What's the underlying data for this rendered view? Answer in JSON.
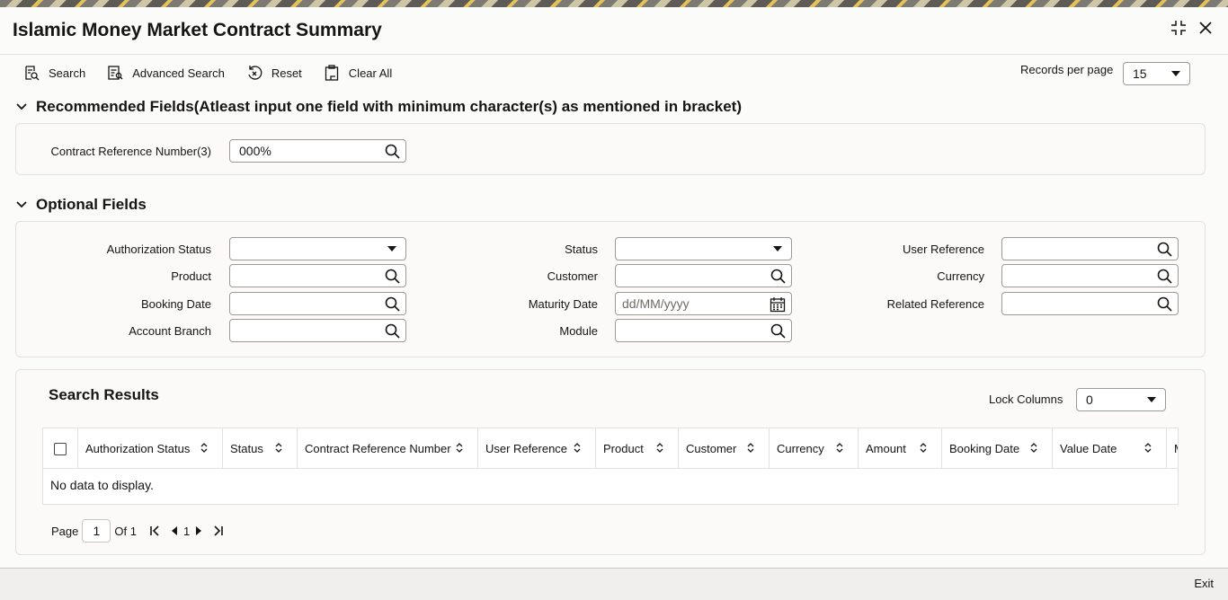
{
  "window": {
    "title": "Islamic Money Market Contract Summary"
  },
  "toolbar": {
    "search_label": "Search",
    "advanced_search_label": "Advanced Search",
    "reset_label": "Reset",
    "clear_all_label": "Clear All",
    "records_per_page_label": "Records per page",
    "records_per_page_value": "15"
  },
  "recommended": {
    "heading": "Recommended Fields(Atleast input one field with minimum character(s) as mentioned in bracket)",
    "contract_ref_label": "Contract Reference Number(3)",
    "contract_ref_value": "000%"
  },
  "optional": {
    "heading": "Optional Fields",
    "authorization_status_label": "Authorization Status",
    "authorization_status_value": "",
    "product_label": "Product",
    "booking_date_label": "Booking Date",
    "account_branch_label": "Account Branch",
    "status_label": "Status",
    "status_value": "",
    "customer_label": "Customer",
    "maturity_date_label": "Maturity Date",
    "maturity_date_placeholder": "dd/MM/yyyy",
    "module_label": "Module",
    "user_reference_label": "User Reference",
    "currency_label": "Currency",
    "related_reference_label": "Related Reference"
  },
  "results": {
    "heading": "Search Results",
    "lock_columns_label": "Lock Columns",
    "lock_columns_value": "0",
    "columns": [
      "Authorization Status",
      "Status",
      "Contract Reference Number",
      "User Reference",
      "Product",
      "Customer",
      "Currency",
      "Amount",
      "Booking Date",
      "Value Date",
      "M"
    ],
    "empty_message": "No data to display."
  },
  "pager": {
    "page_label": "Page",
    "page_value": "1",
    "of_label": "Of 1",
    "current_page": "1"
  },
  "footer": {
    "exit_label": "Exit"
  },
  "icons": {
    "maximize": "maximize-icon",
    "close": "close-icon",
    "search": "search-icon",
    "calendar": "calendar-icon"
  },
  "colors": {
    "text": "#161513",
    "border": "#9e9a93",
    "background": "#fbfbfa"
  }
}
